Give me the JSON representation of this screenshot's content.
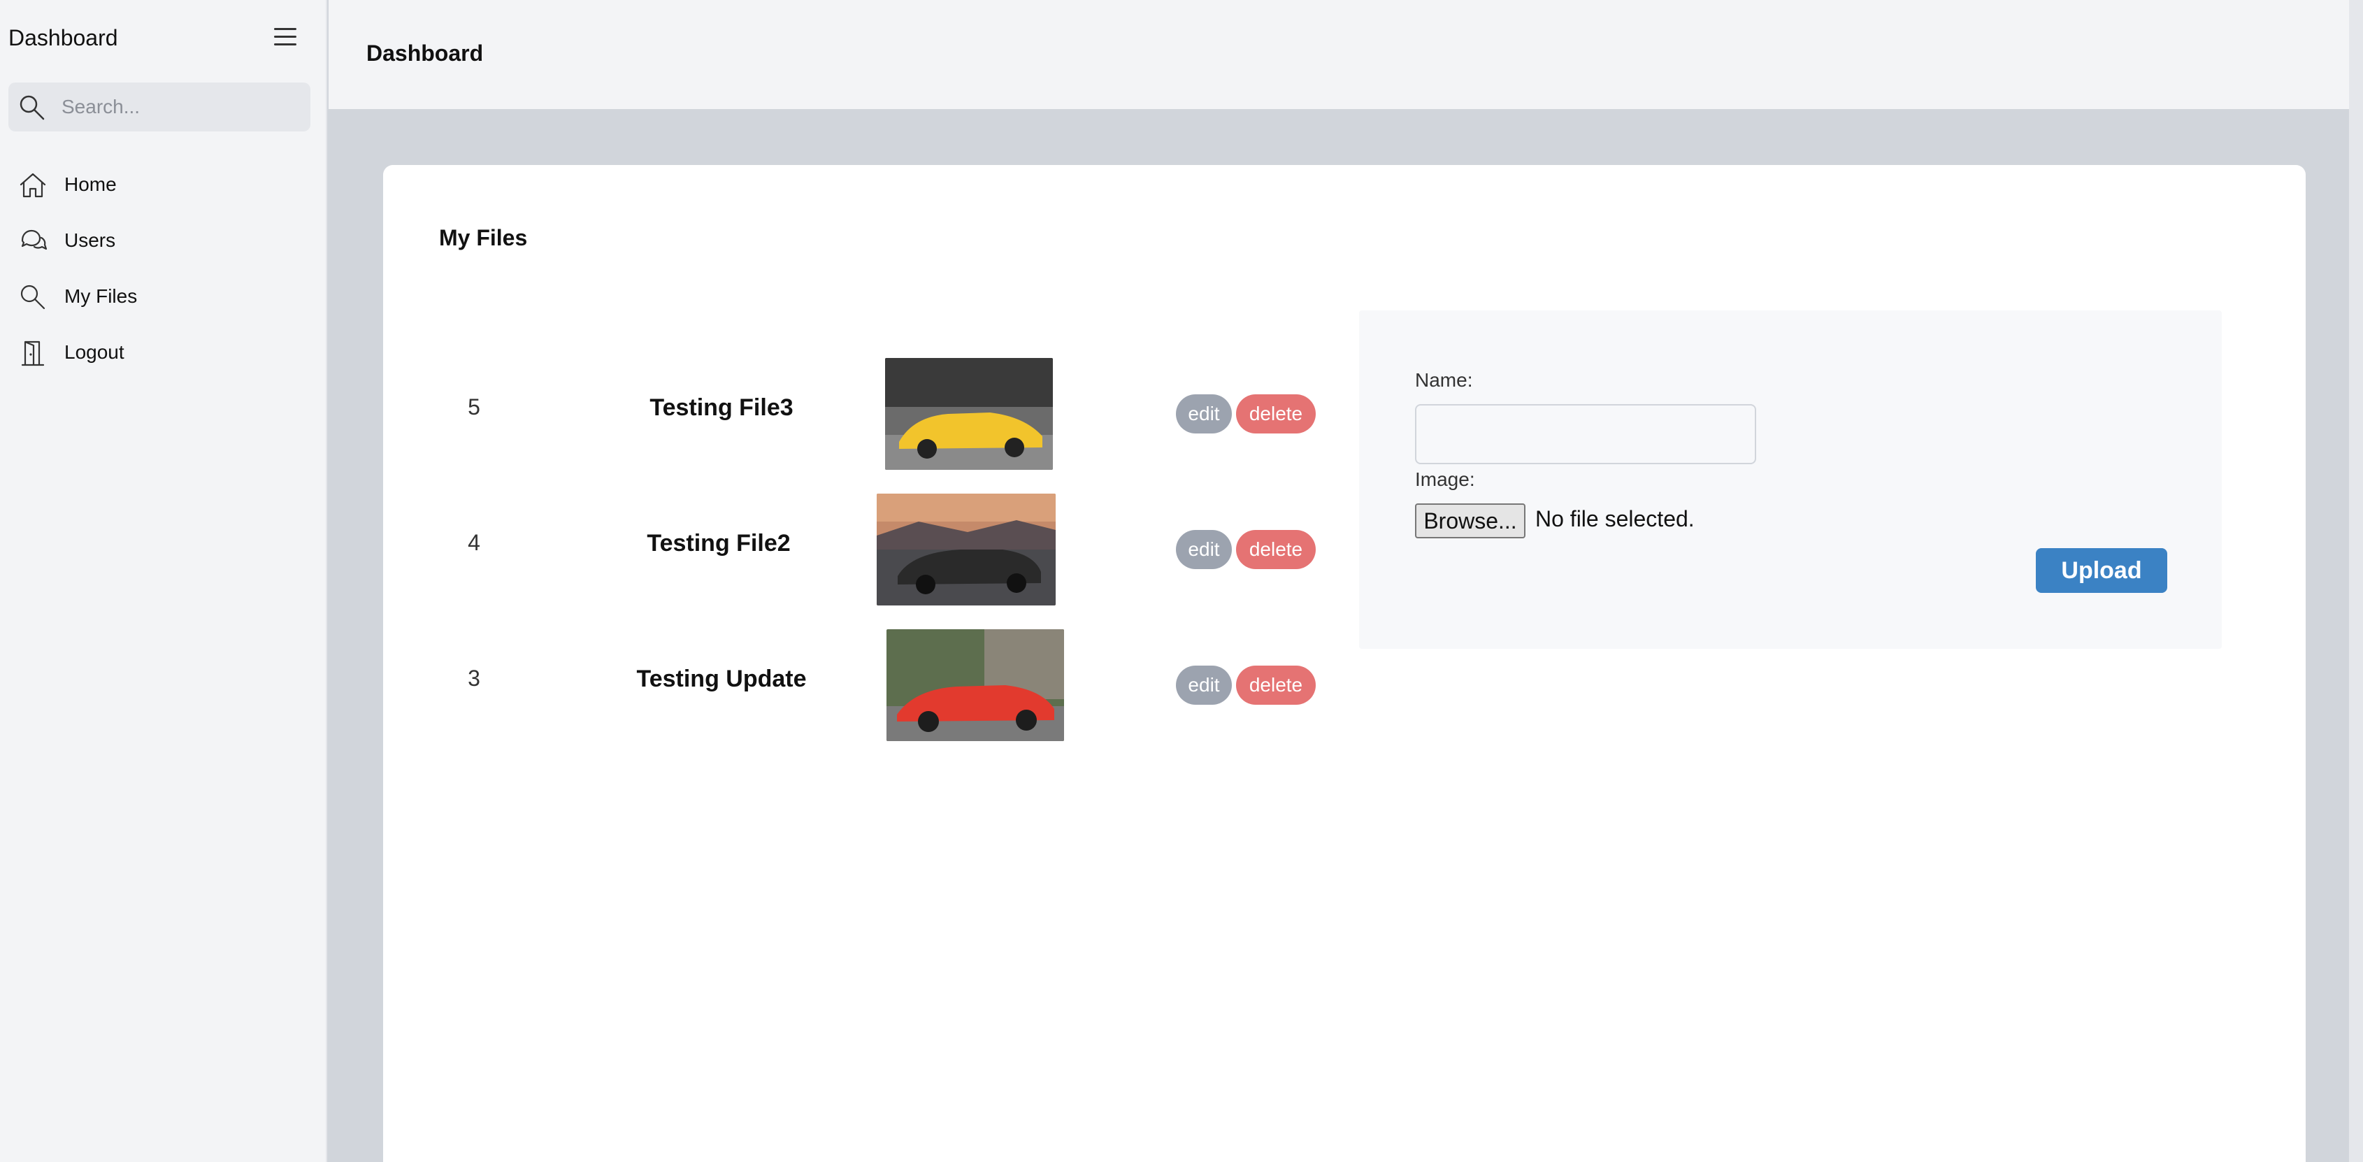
{
  "sidebar": {
    "brand": "Dashboard",
    "search_placeholder": "Search...",
    "items": [
      {
        "label": "Home",
        "icon": "home-icon"
      },
      {
        "label": "Users",
        "icon": "chat-icon"
      },
      {
        "label": "My Files",
        "icon": "search-icon"
      },
      {
        "label": "Logout",
        "icon": "door-icon"
      }
    ]
  },
  "header": {
    "title": "Dashboard"
  },
  "main": {
    "title": "My Files",
    "files": [
      {
        "id": "5",
        "name": "Testing File3",
        "edit_label": "edit",
        "delete_label": "delete",
        "car_color": "#f2c42c",
        "bg_color": "#6b6b6b"
      },
      {
        "id": "4",
        "name": "Testing File2",
        "edit_label": "edit",
        "delete_label": "delete",
        "car_color": "#2a2a2a",
        "bg_color": "#c58a6a"
      },
      {
        "id": "3",
        "name": "Testing Update",
        "edit_label": "edit",
        "delete_label": "delete",
        "car_color": "#e23a2e",
        "bg_color": "#5d6e4e"
      }
    ],
    "upload": {
      "name_label": "Name:",
      "name_value": "",
      "image_label": "Image:",
      "browse_label": "Browse...",
      "file_status": "No file selected.",
      "upload_label": "Upload"
    }
  },
  "colors": {
    "accent": "#3b82c4",
    "delete": "#e57373",
    "edit": "#9ca3af"
  }
}
